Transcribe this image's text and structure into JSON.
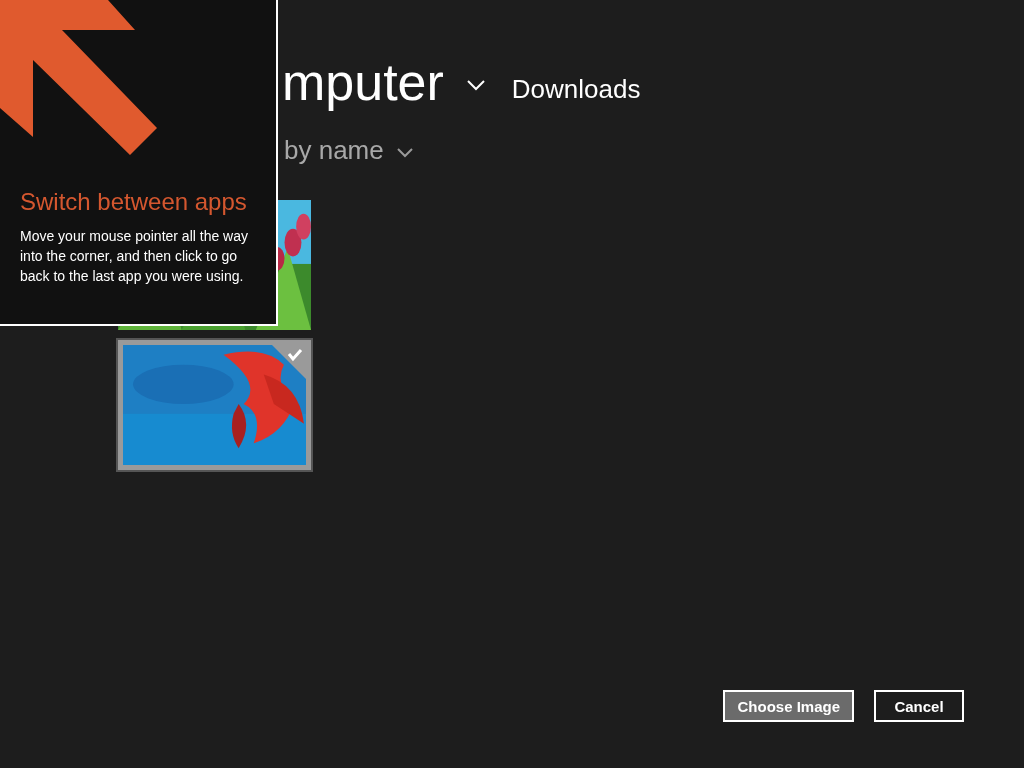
{
  "header": {
    "location": "mputer",
    "folder": "Downloads"
  },
  "sort": {
    "label": "by name"
  },
  "thumbnails": [
    {
      "kind": "picture",
      "selected": false
    },
    {
      "kind": "picture",
      "selected": true
    }
  ],
  "buttons": [
    {
      "label": "Choose Image",
      "default": true
    },
    {
      "label": "Cancel",
      "default": false
    }
  ],
  "tip": {
    "title": "Switch between apps",
    "body": "Move your mouse pointer all the way into the corner, and then click to go back to the last app you were using."
  }
}
